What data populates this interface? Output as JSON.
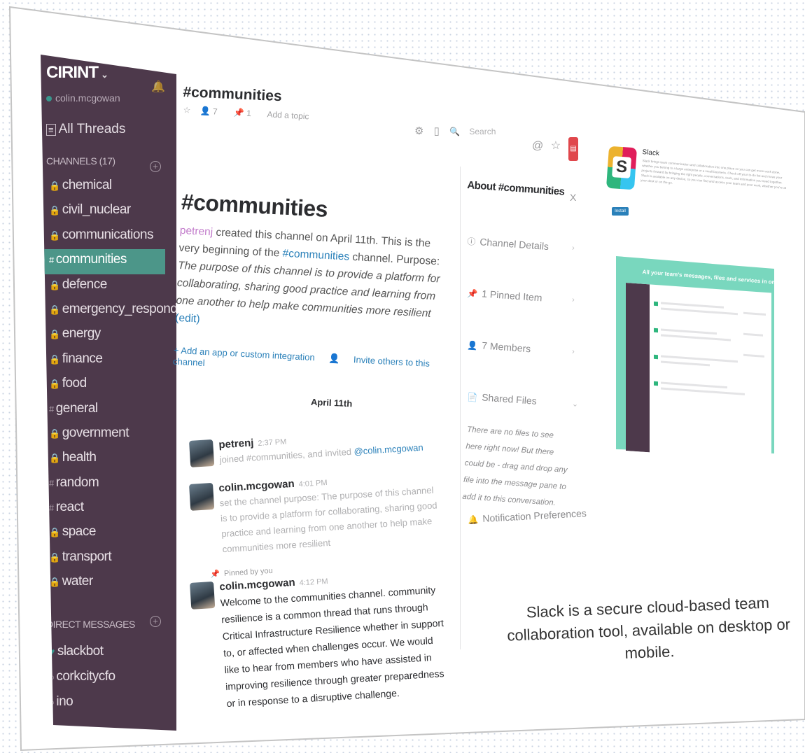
{
  "sidebar": {
    "team": "CIRINT",
    "user": "colin.mcgowan",
    "all_threads": "All Threads",
    "channels_header": "CHANNELS (17)",
    "channels": [
      {
        "prefix": "🔒",
        "name": "chemical",
        "active": false
      },
      {
        "prefix": "🔒",
        "name": "civil_nuclear",
        "active": false
      },
      {
        "prefix": "🔒",
        "name": "communications",
        "active": false
      },
      {
        "prefix": "#",
        "name": "communities",
        "active": true
      },
      {
        "prefix": "🔒",
        "name": "defence",
        "active": false
      },
      {
        "prefix": "🔒",
        "name": "emergency_responders",
        "active": false
      },
      {
        "prefix": "🔒",
        "name": "energy",
        "active": false
      },
      {
        "prefix": "🔒",
        "name": "finance",
        "active": false
      },
      {
        "prefix": "🔒",
        "name": "food",
        "active": false
      },
      {
        "prefix": "#",
        "name": "general",
        "active": false
      },
      {
        "prefix": "🔒",
        "name": "government",
        "active": false
      },
      {
        "prefix": "🔒",
        "name": "health",
        "active": false
      },
      {
        "prefix": "#",
        "name": "random",
        "active": false
      },
      {
        "prefix": "#",
        "name": "react",
        "active": false
      },
      {
        "prefix": "🔒",
        "name": "space",
        "active": false
      },
      {
        "prefix": "🔒",
        "name": "transport",
        "active": false
      },
      {
        "prefix": "🔒",
        "name": "water",
        "active": false
      }
    ],
    "dm_header": "DIRECT MESSAGES",
    "dms": [
      {
        "prefix": "♥",
        "name": "slackbot"
      },
      {
        "prefix": "○",
        "name": "corkcitycfo"
      },
      {
        "prefix": "○",
        "name": "ino"
      }
    ]
  },
  "header": {
    "channel": "#communities",
    "star": "☆",
    "members": "7",
    "pins": "1",
    "add_topic": "Add a topic",
    "search_placeholder": "Search"
  },
  "intro": {
    "heading": "#communities",
    "creator": "petrenj",
    "created_text": " created this channel on April 11th. This is the very beginning of the ",
    "channel_link": "#communities",
    "purpose_label": " channel. Purpose: ",
    "purpose": "The purpose of this channel is to provide a platform for collaborating, sharing good practice and learning from one another to help make communities more resilient",
    "edit": "(edit)",
    "add_app": "+ Add an app or custom integration",
    "invite": "Invite others to this channel"
  },
  "date_divider": "April 11th",
  "messages": [
    {
      "user": "petrenj",
      "time": "2:37 PM",
      "body": "joined #communities, and invited ",
      "mention": "@colin.mcgowan"
    },
    {
      "user": "colin.mcgowan",
      "time": "4:01 PM",
      "body": "set the channel purpose: The purpose of this channel is to provide a platform for collaborating, sharing good practice and learning from one another to help make communities more resilient"
    },
    {
      "pinned": "Pinned by you",
      "user": "colin.mcgowan",
      "time": "4:12 PM",
      "body": "Welcome to the communities channel. community resilience is a common thread that runs through Critical Infrastructure Resilience whether in support to, or affected when challenges occur. We would like to hear from members who have assisted in improving resilience through greater preparedness or in response to a disruptive challenge."
    }
  ],
  "about": {
    "title": "About #communities",
    "close": "X",
    "rows": [
      {
        "icon": "ⓘ",
        "label": "Channel Details"
      },
      {
        "icon": "📌",
        "label": "1 Pinned Item"
      },
      {
        "icon": "👤",
        "label": "7 Members"
      },
      {
        "icon": "📄",
        "label": "Shared Files"
      }
    ],
    "files_empty": "There are no files to see here right now! But there could be - drag and drop any file into the message pane to add it to this conversation.",
    "notifications": "Notification Preferences"
  },
  "promo": {
    "name": "Slack",
    "description": "Slack brings team communication and collaboration into one place so you can get more work done, whether you belong to a large enterprise or a small business. Check off your to-do list and move your projects forward by bringing the right people, conversations, tools, and information you need together. Slack is available on any device, so you can find and access your team and your work, whether you're at your desk or on the go.",
    "install": "Install",
    "tagline": "All your team's messages, files and services in one place."
  },
  "caption": "Slack is a secure cloud-based team collaboration tool, available on desktop or mobile.",
  "colors": {
    "sidebar": "#4d394b",
    "active": "#4c9689",
    "link": "#2a80b9",
    "promo": "#79d7be"
  }
}
